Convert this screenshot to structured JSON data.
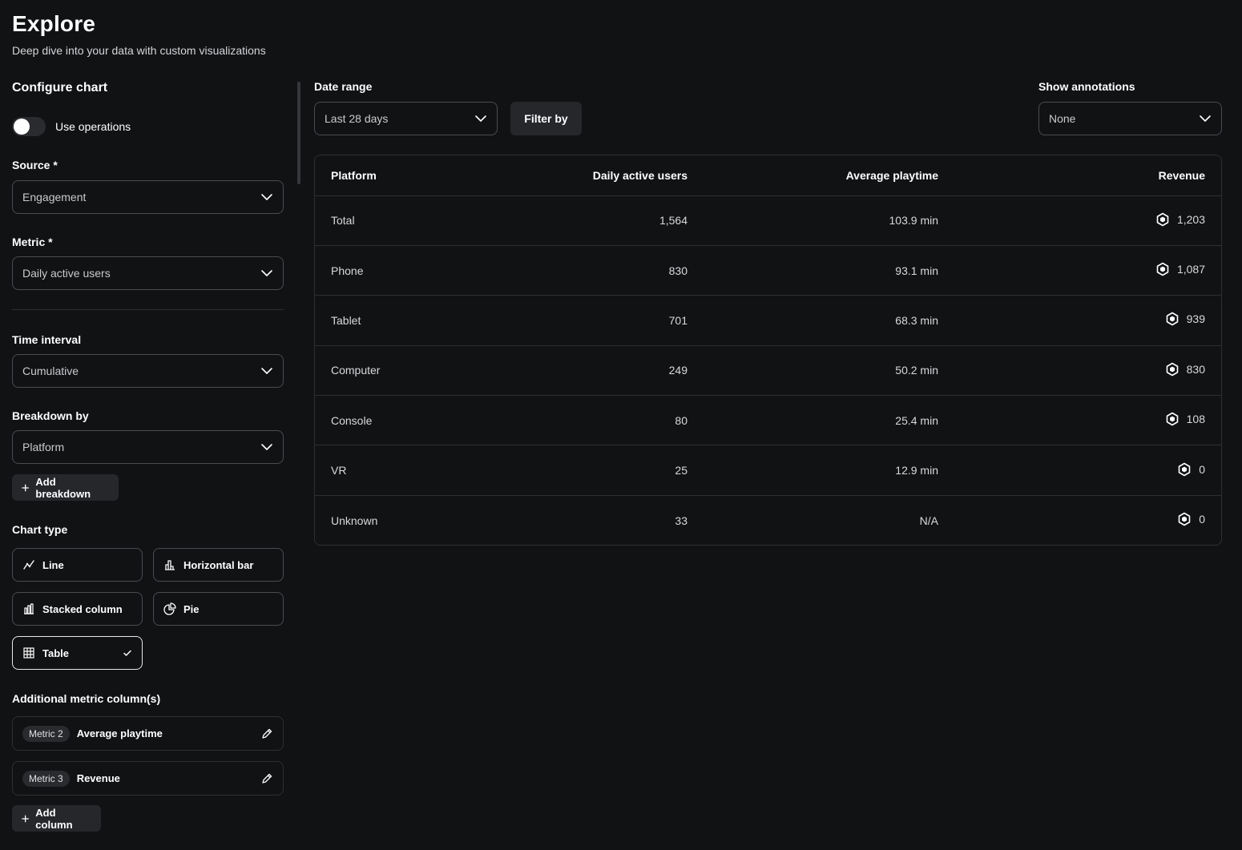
{
  "header": {
    "title": "Explore",
    "subtitle": "Deep dive into your data with custom visualizations"
  },
  "sidebar": {
    "configure_title": "Configure chart",
    "use_operations_label": "Use operations",
    "use_operations_on": false,
    "source": {
      "label": "Source *",
      "value": "Engagement"
    },
    "metric": {
      "label": "Metric *",
      "value": "Daily active users"
    },
    "time_interval": {
      "label": "Time interval",
      "value": "Cumulative"
    },
    "breakdown": {
      "label": "Breakdown by",
      "value": "Platform",
      "add_label": "Add breakdown"
    },
    "chart_type": {
      "label": "Chart type",
      "options": [
        {
          "label": "Line",
          "icon": "line-chart-icon",
          "selected": false
        },
        {
          "label": "Horizontal bar",
          "icon": "horizontal-bar-icon",
          "selected": false
        },
        {
          "label": "Stacked column",
          "icon": "stacked-column-icon",
          "selected": false
        },
        {
          "label": "Pie",
          "icon": "pie-chart-icon",
          "selected": false
        },
        {
          "label": "Table",
          "icon": "table-icon",
          "selected": true
        }
      ]
    },
    "additional": {
      "label": "Additional metric column(s)",
      "items": [
        {
          "tag": "Metric 2",
          "name": "Average playtime"
        },
        {
          "tag": "Metric 3",
          "name": "Revenue"
        }
      ],
      "add_label": "Add column"
    }
  },
  "toolbar": {
    "date_range": {
      "label": "Date range",
      "value": "Last 28 days"
    },
    "filter_label": "Filter by",
    "annotations": {
      "label": "Show annotations",
      "value": "None"
    }
  },
  "table": {
    "headers": [
      "Platform",
      "Daily active users",
      "Average playtime",
      "Revenue"
    ],
    "rows": [
      [
        "Total",
        "1,564",
        "103.9 min",
        "1,203"
      ],
      [
        "Phone",
        "830",
        "93.1 min",
        "1,087"
      ],
      [
        "Tablet",
        "701",
        "68.3 min",
        "939"
      ],
      [
        "Computer",
        "249",
        "50.2 min",
        "830"
      ],
      [
        "Console",
        "80",
        "25.4 min",
        "108"
      ],
      [
        "VR",
        "25",
        "12.9 min",
        "0"
      ],
      [
        "Unknown",
        "33",
        "N/A",
        "0"
      ]
    ]
  },
  "icons": {
    "chevron": "chevron-down-icon",
    "plus": "plus-icon",
    "edit": "pencil-icon",
    "currency": "robux-icon",
    "check": "checkmark-icon"
  }
}
